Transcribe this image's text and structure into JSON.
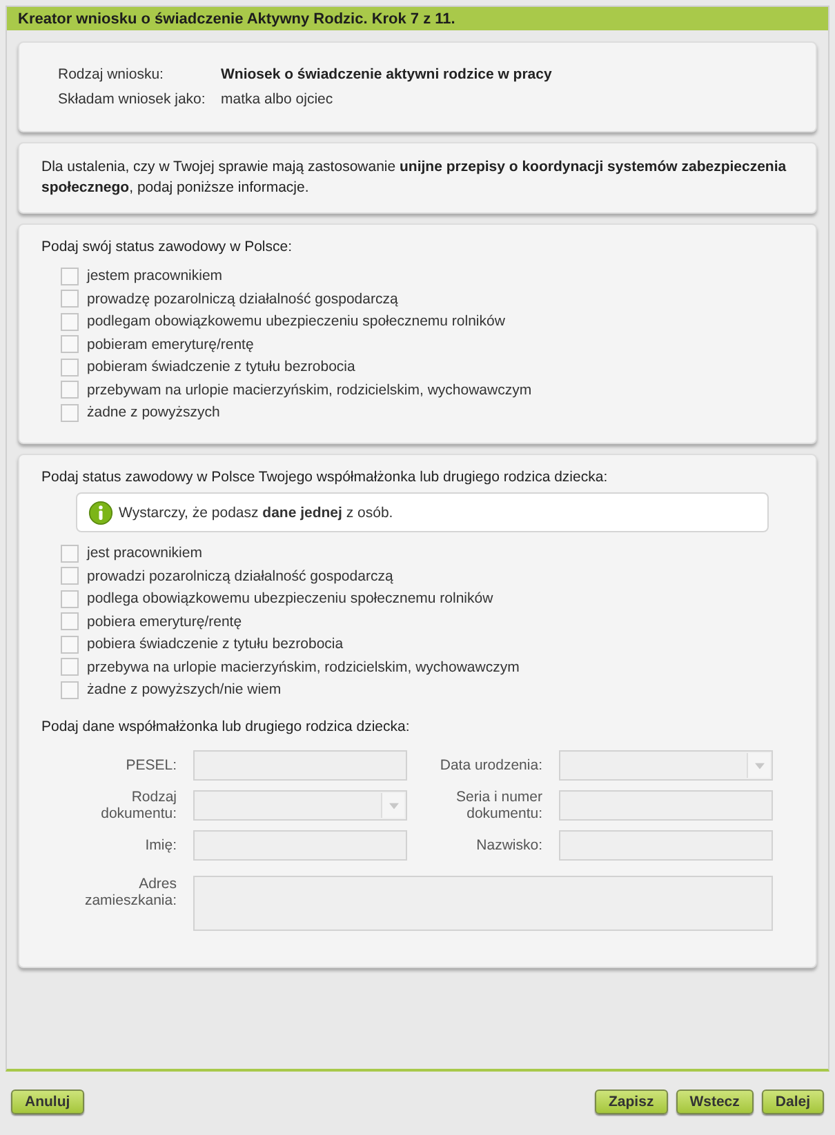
{
  "window": {
    "title": "Kreator wniosku o świadczenie Aktywny Rodzic. Krok 7 z 11."
  },
  "summary": [
    {
      "label": "Rodzaj wniosku:",
      "value": "Wniosek o świadczenie aktywni rodzice w pracy",
      "bold": true
    },
    {
      "label": "Składam wniosek jako:",
      "value": "matka albo ojciec",
      "bold": false
    }
  ],
  "intro": "Dla ustalenia, czy w Twojej sprawie mają zastosowanie **unijne przepisy o koordynacji systemów zabezpieczenia społecznego**, podaj poniższe informacje.",
  "own_status": {
    "question": "Podaj swój status zawodowy w Polsce:",
    "options": [
      {
        "label": "jestem pracownikiem",
        "checked": false
      },
      {
        "label": "prowadzę pozarolniczą działalność gospodarczą",
        "checked": false
      },
      {
        "label": "podlegam obowiązkowemu ubezpieczeniu społecznemu rolników",
        "checked": false
      },
      {
        "label": "pobieram emeryturę/rentę",
        "checked": false
      },
      {
        "label": "pobieram świadczenie z tytułu bezrobocia",
        "checked": false
      },
      {
        "label": "przebywam na urlopie macierzyńskim, rodzicielskim, wychowawczym",
        "checked": false
      },
      {
        "label": "żadne z powyższych",
        "checked": false
      }
    ]
  },
  "partner_status": {
    "question": "Podaj status zawodowy w Polsce Twojego współmałżonka lub drugiego rodzica dziecka:",
    "info": "Wystarczy, że podasz **dane jednej** z osób.",
    "options": [
      {
        "label": "jest pracownikiem",
        "checked": false
      },
      {
        "label": "prowadzi pozarolniczą działalność gospodarczą",
        "checked": false
      },
      {
        "label": "podlega obowiązkowemu ubezpieczeniu społecznemu rolników",
        "checked": false
      },
      {
        "label": "pobiera emeryturę/rentę",
        "checked": false
      },
      {
        "label": "pobiera świadczenie z tytułu bezrobocia",
        "checked": false
      },
      {
        "label": "przebywa na urlopie macierzyńskim, rodzicielskim, wychowawczym",
        "checked": false
      },
      {
        "label": "żadne z powyższych/nie wiem",
        "checked": false
      }
    ]
  },
  "partner_data": {
    "heading": "Podaj dane współmałżonka lub drugiego rodzica dziecka:",
    "fields": [
      {
        "label": "PESEL:",
        "kind": "text",
        "disabled": true
      },
      {
        "label": "Data urodzenia:",
        "kind": "select",
        "disabled": true
      },
      {
        "label": "Rodzaj dokumentu:",
        "kind": "select",
        "disabled": true
      },
      {
        "label": "Seria i numer dokumentu:",
        "kind": "text",
        "disabled": true
      },
      {
        "label": "Imię:",
        "kind": "text",
        "disabled": true
      },
      {
        "label": "Nazwisko:",
        "kind": "text",
        "disabled": true
      },
      {
        "label": "Adres zamieszkania:",
        "kind": "textarea",
        "disabled": true
      }
    ]
  },
  "buttons_left": [
    "Anuluj"
  ],
  "buttons_right": [
    "Zapisz",
    "Wstecz",
    "Dalej"
  ]
}
